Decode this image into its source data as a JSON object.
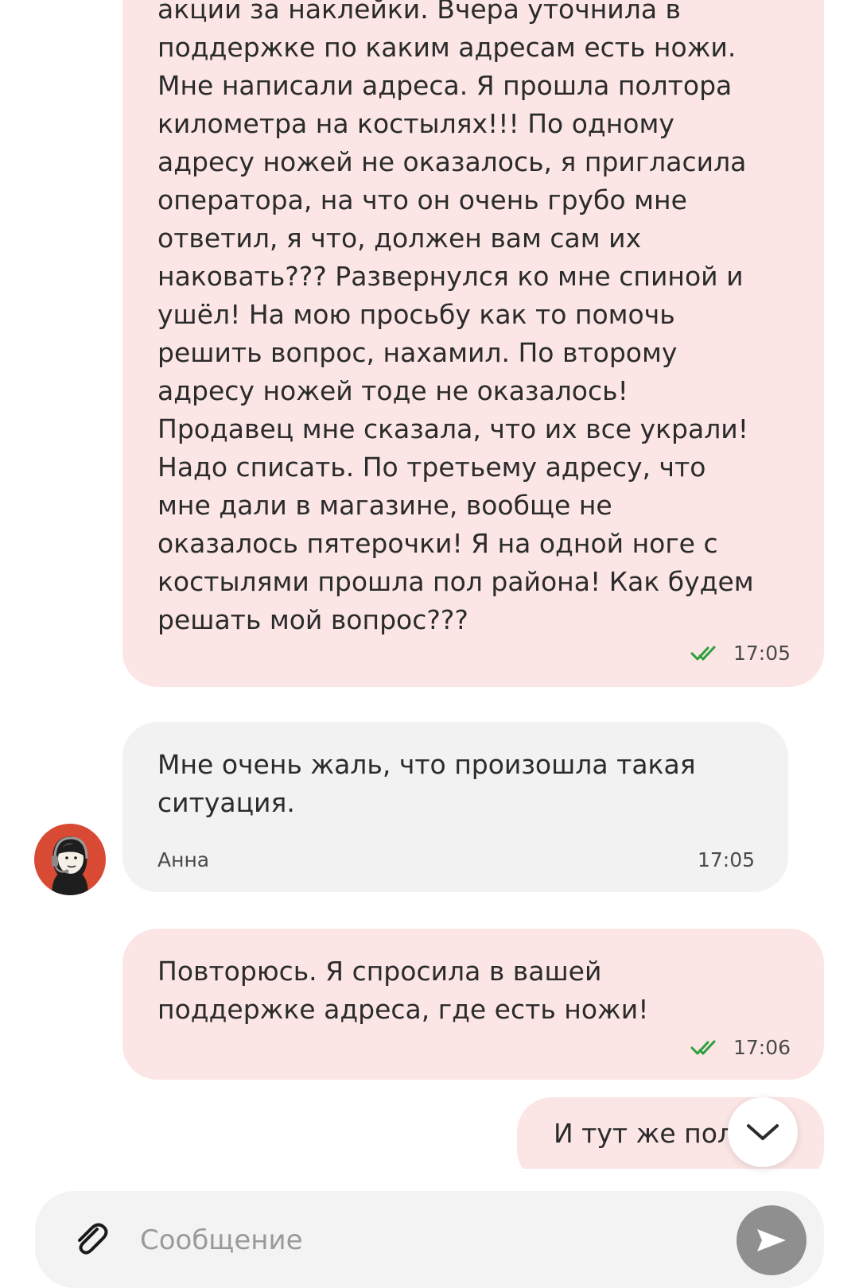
{
  "messages": [
    {
      "text": "акции за наклейки. Вчера уточнила в\nподдержке по каким адресам есть ножи.\nМне написали адреса. Я прошла полтора\nкилометра на костылях!!! По одному\nадресу ножей не оказалось, я пригласила\nоператора, на что он очень грубо мне\nответил, я что, должен вам сам их\nнаковать??? Развернулся ко мне спиной и\nушёл! На мою просьбу как то помочь\nрешить вопрос, нахамил. По второму\nадресу ножей тоде не оказалось!\nПродавец мне сказала, что их все украли!\nНадо списать. По третьему адресу, что\nмне дали в магазине, вообще не\nоказалось пятерочки! Я на одной ноге с\nкостылями прошла пол района! Как будем\nрешать мой вопрос???",
      "time": "17:05",
      "status_icon": "double-check-icon"
    },
    {
      "text": "Мне очень жаль, что произошла такая\nситуация.",
      "author": "Анна",
      "time": "17:05"
    },
    {
      "text": "Повторюсь. Я спросила в вашей\nподдержке адреса, где есть ножи!",
      "time": "17:06",
      "status_icon": "double-check-icon"
    },
    {
      "text": "И тут же пол"
    }
  ],
  "composer": {
    "placeholder": "Сообщение",
    "attach_icon": "paperclip-icon",
    "send_icon": "send-icon"
  },
  "scroll_button_icon": "chevron-down-icon",
  "colors": {
    "outgoing_bubble": "#fbe6e5",
    "incoming_bubble": "#f2f2f2",
    "check": "#2e9e3e",
    "send_button": "#8f8f8f",
    "avatar_bg": "#d94a35"
  }
}
